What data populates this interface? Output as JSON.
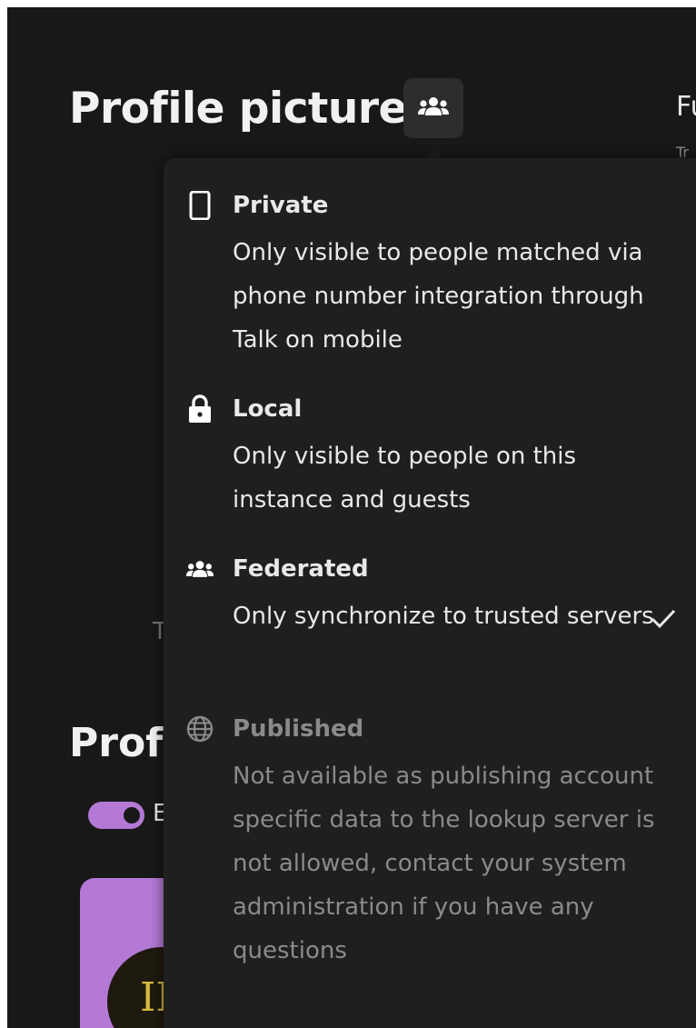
{
  "header": {
    "title": "Profile picture",
    "visibility_icon": "people-group-icon",
    "clipped_right_label": "Fu",
    "clipped_right_sublabel": "Tr"
  },
  "background": {
    "section_title": "Prof",
    "toggle_label": "E",
    "faint_text": "T",
    "card_initial": "II"
  },
  "popover": {
    "options": [
      {
        "icon": "phone-icon",
        "title": "Private",
        "description": "Only visible to people matched via phone number integration through Talk on mobile",
        "selected": false,
        "disabled": false
      },
      {
        "icon": "lock-icon",
        "title": "Local",
        "description": "Only visible to people on this instance and guests",
        "selected": false,
        "disabled": false
      },
      {
        "icon": "people-group-icon",
        "title": "Federated",
        "description": "Only synchronize to trusted servers",
        "selected": true,
        "disabled": false
      },
      {
        "icon": "globe-icon",
        "title": "Published",
        "description": "Not available as publishing account specific data to the lookup server is not allowed, contact your system administration if you have any questions",
        "selected": false,
        "disabled": true
      }
    ]
  },
  "colors": {
    "background": "#181818",
    "popover": "#1f1f1f",
    "accent": "#b379d5",
    "text": "#e9e9e9",
    "disabled_text": "#8a8a8a"
  }
}
